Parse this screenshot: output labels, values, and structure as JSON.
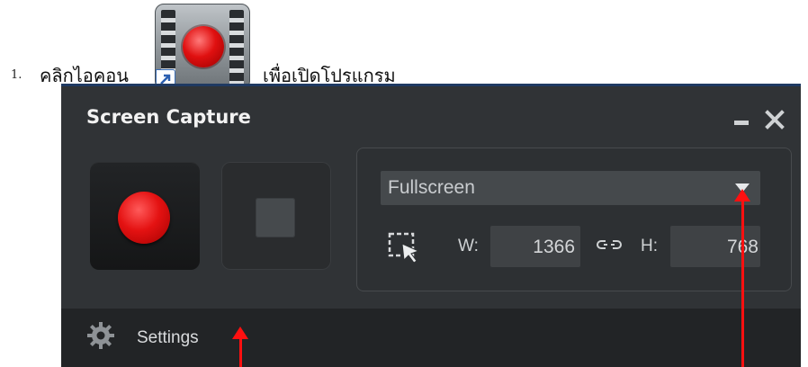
{
  "instruction": {
    "number": "1.",
    "text_before_icon": "คลิกไอคอน",
    "text_after_icon": "เพื่อเปิดโปรแกรม"
  },
  "window": {
    "title": "Screen Capture",
    "minimize_icon": "minimize-icon",
    "close_icon": "close-icon"
  },
  "controls": {
    "record_icon": "record-icon",
    "stop_icon": "stop-icon"
  },
  "capture": {
    "mode": "Fullscreen",
    "width_label": "W:",
    "width_value": "1366",
    "height_label": "H:",
    "height_value": "768",
    "region_icon": "region-select-icon",
    "link_icon": "link-icon"
  },
  "footer": {
    "settings_label": "Settings",
    "settings_icon": "gear-icon"
  },
  "colors": {
    "window_bg": "#303336",
    "record_red": "#e41212",
    "annotation_red": "#ff1010"
  }
}
